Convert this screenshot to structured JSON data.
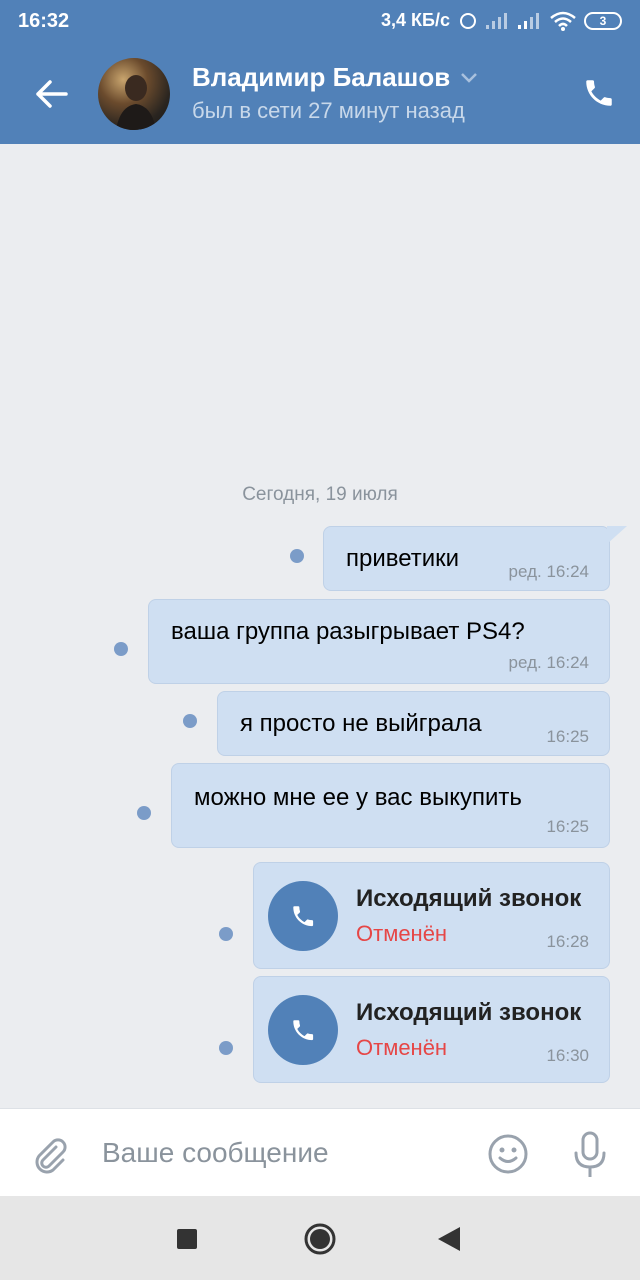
{
  "status_bar": {
    "time": "16:32",
    "speed": "3,4 КБ/с",
    "battery": "3"
  },
  "header": {
    "contact_name": "Владимир Балашов",
    "last_seen": "был в сети 27 минут назад"
  },
  "chat": {
    "date_separator": "Сегодня, 19 июля",
    "messages": [
      {
        "text": "приветики",
        "time": "ред. 16:24"
      },
      {
        "text": "ваша группа разыгрывает PS4?",
        "time": "ред. 16:24"
      },
      {
        "text": "я просто не выйграла",
        "time": "16:25"
      },
      {
        "text": "можно мне ее у вас выкупить",
        "time": "16:25"
      }
    ],
    "calls": [
      {
        "title": "Исходящий звонок",
        "status": "Отменён",
        "time": "16:28"
      },
      {
        "title": "Исходящий звонок",
        "status": "Отменён",
        "time": "16:30"
      }
    ]
  },
  "composer": {
    "placeholder": "Ваше сообщение"
  },
  "colors": {
    "header": "#5181b8",
    "bubble": "#cfdff2",
    "cancelled": "#e64646"
  }
}
